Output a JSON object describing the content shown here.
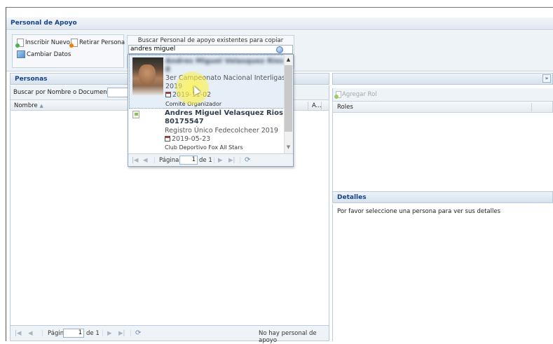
{
  "window": {
    "title": "Personal de Apoyo"
  },
  "toolbar": {
    "inscribir_label": "Inscribir Nuevo",
    "retirar_label": "Retirar Persona",
    "cambiar_label": "Cambiar Datos"
  },
  "search": {
    "label": "Buscar Personal de apoyo existentes para copiar",
    "value": "andres miguel"
  },
  "results": [
    {
      "name_line1": "Andres Miguel Velasquez Rios",
      "name_line2": "8",
      "event": "3er Campeonato Nacional Interligas",
      "year": "2019",
      "date": "2019-11-02",
      "club": "Comité Organizador",
      "has_photo": true
    },
    {
      "name_line1": "Andres Miguel Velasquez Rios",
      "name_line2": "80175547",
      "event": "Registro Único Fedecolcheer 2019",
      "date": "2019-05-23",
      "club": "Club Deportivo Fox All Stars",
      "has_photo": false
    }
  ],
  "dropdown_pager": {
    "page_label": "Página",
    "page_value": "1",
    "of_label": "de 1"
  },
  "personas": {
    "title": "Personas",
    "filter_label": "Buscar por Nombre o Documento:",
    "col_nombre": "Nombre",
    "col_a": "A...",
    "pager": {
      "page_label": "Página",
      "page_value": "1",
      "of_label": "de 1",
      "status": "No hay personal de apoyo"
    }
  },
  "roles": {
    "add_label": "Agregar Rol",
    "col_roles": "Roles",
    "collapse_symbol": "»"
  },
  "detalles": {
    "title": "Detalles",
    "message": "Por favor seleccione una persona para ver sus detalles"
  },
  "icons": {
    "first": "|◀",
    "prev": "◀",
    "next": "▶",
    "last": "▶|",
    "refresh": "⟳",
    "sort": "▲"
  }
}
